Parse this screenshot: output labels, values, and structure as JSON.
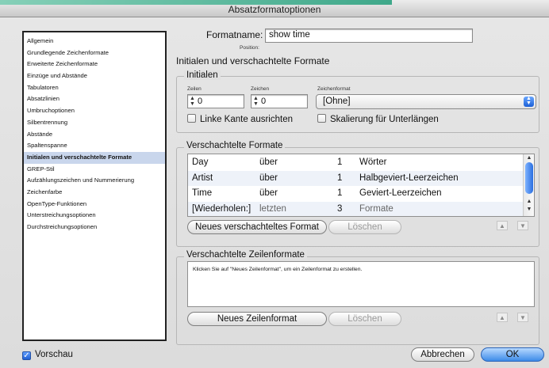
{
  "window": {
    "title": "Absatzformatoptionen"
  },
  "sidebar": {
    "items": [
      {
        "label": "Allgemein",
        "selected": false
      },
      {
        "label": "Grundlegende Zeichenformate",
        "selected": false
      },
      {
        "label": "Erweiterte Zeichenformate",
        "selected": false
      },
      {
        "label": "Einzüge und Abstände",
        "selected": false
      },
      {
        "label": "Tabulatoren",
        "selected": false
      },
      {
        "label": "Absatzlinien",
        "selected": false
      },
      {
        "label": "Umbruchoptionen",
        "selected": false
      },
      {
        "label": "Silbentrennung",
        "selected": false
      },
      {
        "label": "Abstände",
        "selected": false
      },
      {
        "label": "Spaltenspanne",
        "selected": false
      },
      {
        "label": "Initialen und verschachtelte Formate",
        "selected": true
      },
      {
        "label": "GREP-Stil",
        "selected": false
      },
      {
        "label": "Aufzählungszeichen und Nummerierung",
        "selected": false
      },
      {
        "label": "Zeichenfarbe",
        "selected": false
      },
      {
        "label": "OpenType-Funktionen",
        "selected": false
      },
      {
        "label": "Unterstreichungsoptionen",
        "selected": false
      },
      {
        "label": "Durchstreichungsoptionen",
        "selected": false
      }
    ]
  },
  "form": {
    "formatname_label": "Formatname:",
    "formatname_value": "show time",
    "position_label": "Position:",
    "section_title": "Initialen und verschachtelte Formate"
  },
  "initialen": {
    "title": "Initialen",
    "zeilen_label": "Zeilen",
    "zeilen_value": "0",
    "zeichen_label": "Zeichen",
    "zeichen_value": "0",
    "zeichenformat_label": "Zeichenformat",
    "zeichenformat_value": "[Ohne]",
    "linke_kante_label": "Linke Kante ausrichten",
    "skalierung_label": "Skalierung für Unterlängen"
  },
  "verschachtelte": {
    "title": "Verschachtelte Formate",
    "rows": [
      {
        "format": "Day",
        "mode": "über",
        "count": "1",
        "unit": "Wörter"
      },
      {
        "format": "Artist",
        "mode": "über",
        "count": "1",
        "unit": "Halbgeviert-Leerzeichen"
      },
      {
        "format": "Time",
        "mode": "über",
        "count": "1",
        "unit": "Geviert-Leerzeichen"
      },
      {
        "format": "[Wiederholen:]",
        "mode": "letzten",
        "count": "3",
        "unit": "Formate"
      }
    ],
    "new_button": "Neues verschachteltes Format",
    "delete_button": "Löschen",
    "move_up_icon": "▲",
    "move_down_icon": "▼"
  },
  "zeilenformate": {
    "title": "Verschachtelte Zeilenformate",
    "hint": "Klicken Sie auf \"Neues Zeilenformat\", um ein Zeilenformat zu erstellen.",
    "new_button": "Neues Zeilenformat",
    "delete_button": "Löschen",
    "move_up_icon": "▲",
    "move_down_icon": "▼"
  },
  "footer": {
    "preview_label": "Vorschau",
    "cancel_button": "Abbrechen",
    "ok_button": "OK"
  }
}
